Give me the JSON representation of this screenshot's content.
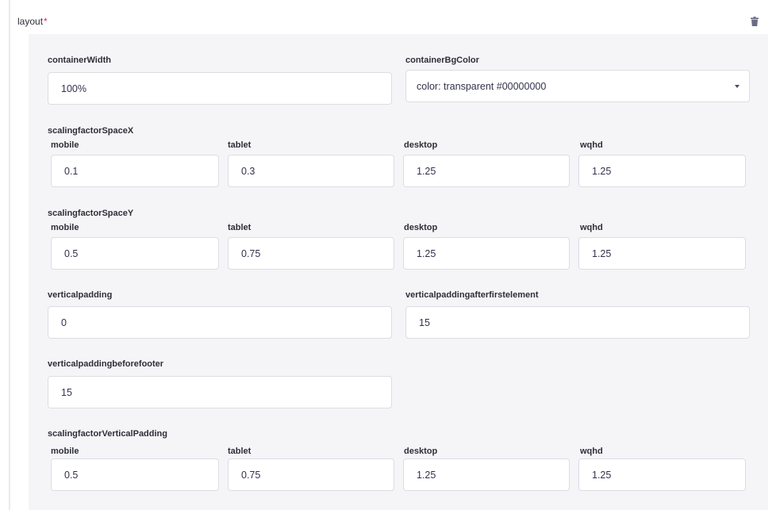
{
  "section": {
    "title": "layout",
    "required_mark": "*"
  },
  "icons": {
    "delete": "trash-icon",
    "dropdown": "chevron-down-icon"
  },
  "container_width": {
    "label": "containerWidth",
    "value": "100%"
  },
  "container_bg_color": {
    "label": "containerBgColor",
    "value": "color: transparent #00000000"
  },
  "scaling_space_x": {
    "label": "scalingfactorSpaceX",
    "fields": [
      {
        "label": "mobile",
        "value": "0.1"
      },
      {
        "label": "tablet",
        "value": "0.3"
      },
      {
        "label": "desktop",
        "value": "1.25"
      },
      {
        "label": "wqhd",
        "value": "1.25"
      }
    ]
  },
  "scaling_space_y": {
    "label": "scalingfactorSpaceY",
    "fields": [
      {
        "label": "mobile",
        "value": "0.5"
      },
      {
        "label": "tablet",
        "value": "0.75"
      },
      {
        "label": "desktop",
        "value": "1.25"
      },
      {
        "label": "wqhd",
        "value": "1.25"
      }
    ]
  },
  "vertical_padding": {
    "label": "verticalpadding",
    "value": "0"
  },
  "vertical_padding_after_first": {
    "label": "verticalpaddingafterfirstelement",
    "value": "15"
  },
  "vertical_padding_before_footer": {
    "label": "verticalpaddingbeforefooter",
    "value": "15"
  },
  "scaling_vertical_padding": {
    "label": "scalingfactorVerticalPadding",
    "fields": [
      {
        "label": "mobile",
        "value": "0.5"
      },
      {
        "label": "tablet",
        "value": "0.75"
      },
      {
        "label": "desktop",
        "value": "1.25"
      },
      {
        "label": "wqhd",
        "value": "1.25"
      }
    ]
  }
}
